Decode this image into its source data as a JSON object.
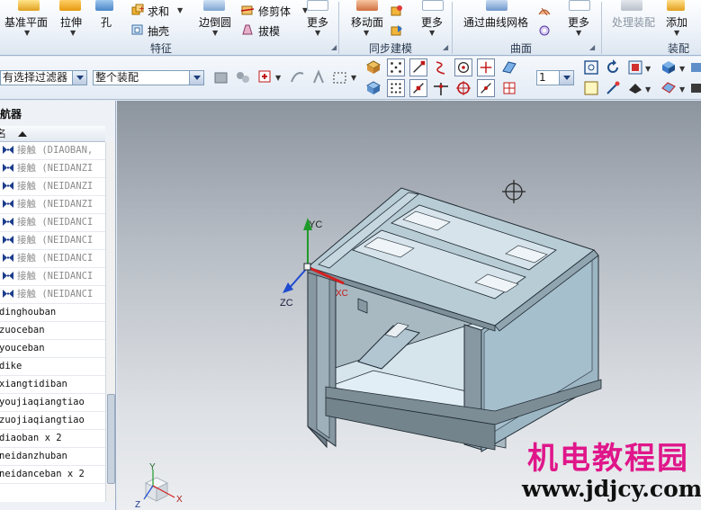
{
  "ribbon": {
    "buttons": {
      "datum_plane": "基准平面",
      "extrude": "拉伸",
      "hole": "孔",
      "unite": "求和",
      "shell": "抽壳",
      "edge_blend": "边倒圆",
      "trim_body": "修剪体",
      "draft": "拔模",
      "more_feature": "更多",
      "move_face": "移动面",
      "more_sync": "更多",
      "through_curve_mesh": "通过曲线网格",
      "more_surface": "更多",
      "process_assembly": "处理装配",
      "add": "添加"
    },
    "groups": {
      "feature": "特征",
      "sync_modeling": "同步建模",
      "surface": "曲面",
      "assembly": "装配"
    }
  },
  "toolbar": {
    "filter_combo": "有选择过滤器",
    "scope_combo": "整个装配",
    "count_combo": "1"
  },
  "navigator": {
    "title": "装配导航器",
    "column_name": "名",
    "contacts": [
      "接触 (DIAOBAN,",
      "接触 (NEIDANZI",
      "接触 (NEIDANZI",
      "接触 (NEIDANZI",
      "接触 (NEIDANCI",
      "接触 (NEIDANCI",
      "接触 (NEIDANCI",
      "接触 (NEIDANCI",
      "接触 (NEIDANCI"
    ],
    "parts": [
      "dinghouban",
      "zuoceban",
      "youceban",
      "dike",
      "xiangtidiban",
      "youjiaqiangtiao",
      "zuojiaqiangtiao",
      "diaoban x 2",
      "neidanzhuban",
      "neidanceban x 2"
    ]
  },
  "viewport": {
    "axis_yc": "YC",
    "axis_zc": "ZC",
    "axis_xc": "XC",
    "triad_y": "Y",
    "triad_z": "Z",
    "triad_x": "X"
  },
  "watermark": {
    "brand": "机电教程园",
    "url": "www.jdjcy.com"
  },
  "colors": {
    "model_face": "#9db6c4",
    "model_edge": "#1f2a32",
    "axis_y": "#1f9a2a",
    "axis_z": "#1f4bd0",
    "axis_x": "#d42020",
    "watermark": "#e0168a"
  }
}
